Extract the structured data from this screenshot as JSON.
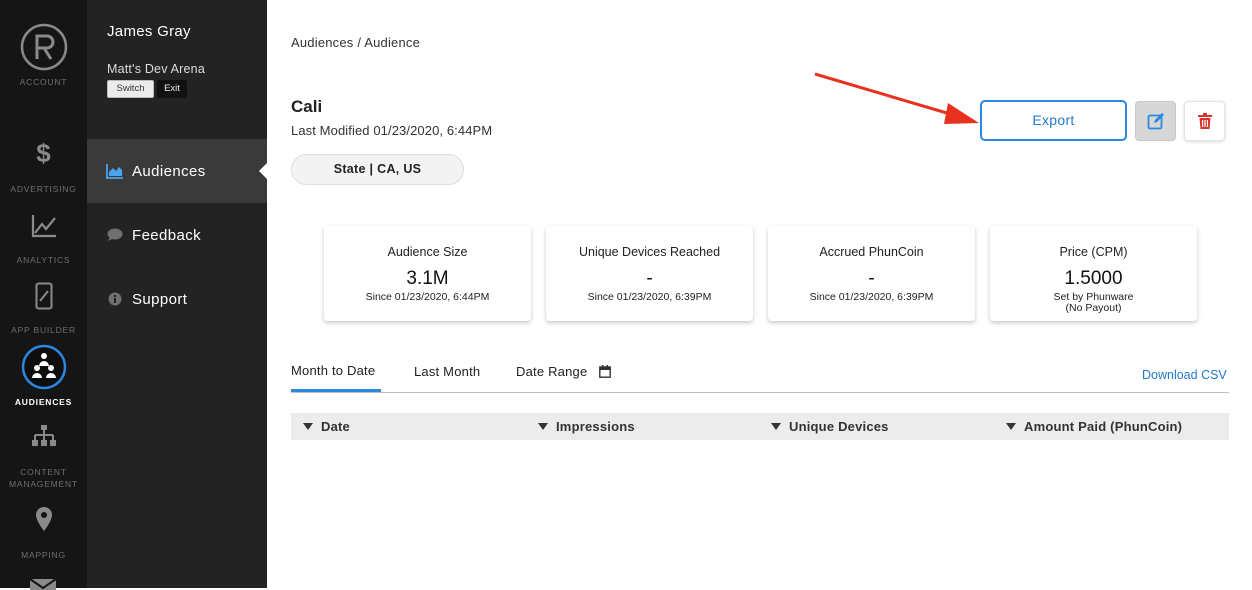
{
  "rail": {
    "account": {
      "label": "ACCOUNT"
    },
    "items": [
      {
        "label": "ADVERTISING",
        "icon": "dollar-icon"
      },
      {
        "label": "ANALYTICS",
        "icon": "line-chart-icon"
      },
      {
        "label": "APP BUILDER",
        "icon": "mobile-edit-icon"
      },
      {
        "label": "AUDIENCES",
        "icon": "audiences-icon",
        "active": true
      },
      {
        "label": "CONTENT",
        "label2": "MANAGEMENT",
        "icon": "sitemap-icon"
      },
      {
        "label": "MAPPING",
        "icon": "map-pin-icon"
      }
    ]
  },
  "nav": {
    "user_name": "James Gray",
    "org_name": "Matt's Dev Arena",
    "switch_label": "Switch",
    "exit_label": "Exit",
    "items": [
      {
        "label": "Audiences",
        "icon": "area-chart-icon",
        "active": true
      },
      {
        "label": "Feedback",
        "icon": "speech-bubble-icon"
      },
      {
        "label": "Support",
        "icon": "info-icon"
      }
    ]
  },
  "main": {
    "breadcrumb": "Audiences / Audience",
    "title": "Cali",
    "modified": "Last Modified 01/23/2020, 6:44PM",
    "chip": "State | CA, US",
    "export_label": "Export",
    "stats": [
      {
        "label": "Audience Size",
        "value": "3.1M",
        "sub": "Since 01/23/2020, 6:44PM",
        "sub2": ""
      },
      {
        "label": "Unique Devices Reached",
        "value": "-",
        "sub": "Since 01/23/2020, 6:39PM",
        "sub2": ""
      },
      {
        "label": "Accrued PhunCoin",
        "value": "-",
        "sub": "Since 01/23/2020, 6:39PM",
        "sub2": ""
      },
      {
        "label": "Price (CPM)",
        "value": "1.5000",
        "sub": "Set by Phunware",
        "sub2": "(No Payout)"
      }
    ],
    "tabs": [
      {
        "label": "Month to Date",
        "active": true
      },
      {
        "label": "Last Month"
      },
      {
        "label": "Date Range"
      }
    ],
    "download_label": "Download CSV",
    "columns": [
      "Date",
      "Impressions",
      "Unique Devices",
      "Amount Paid (PhunCoin)"
    ]
  },
  "colors": {
    "accent": "#2b88e0",
    "delete": "#d9342b",
    "annotation_arrow": "#e8321f",
    "rail_bg": "#151515",
    "nav_bg": "#232323"
  }
}
